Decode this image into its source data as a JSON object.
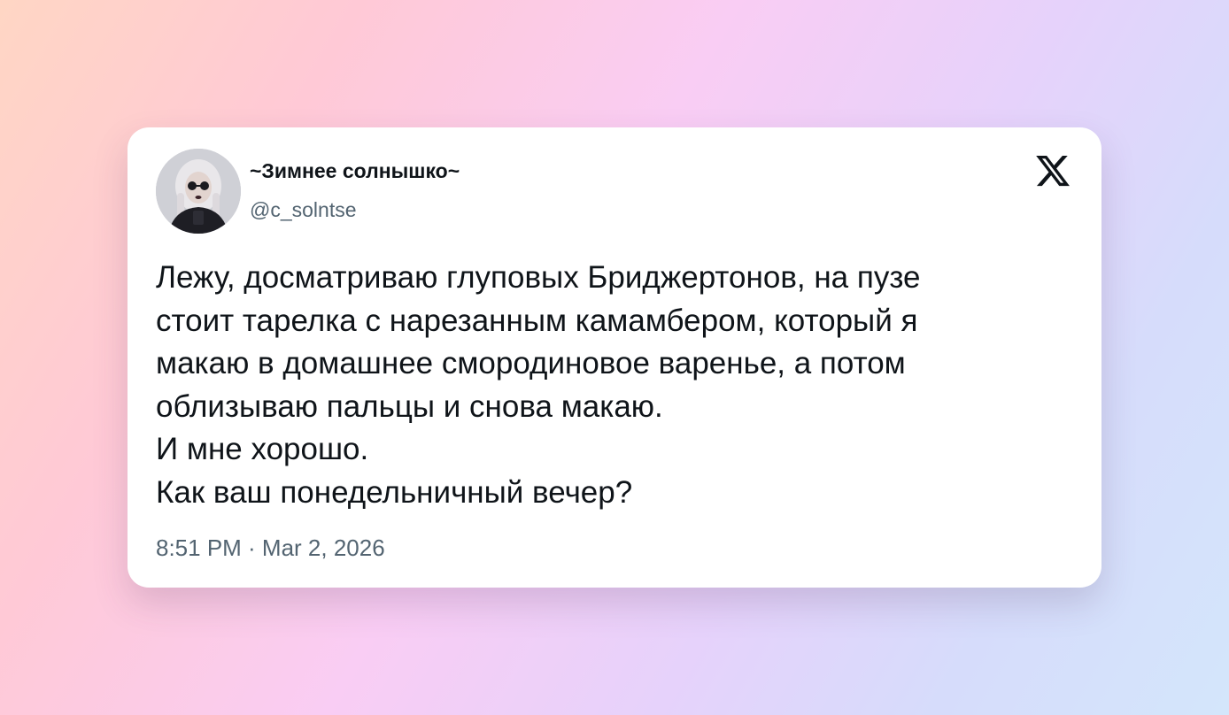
{
  "author": {
    "display_name": "~Зимнее солнышко~",
    "handle": "@c_solntse"
  },
  "tweet": {
    "lines": [
      "Лежу, досматриваю глуповых Бриджертонов, на пузе",
      "стоит тарелка с нарезанным камамбером, который я",
      "макаю в домашнее смородиновое варенье, а потом",
      "облизываю пальцы и снова макаю.",
      "И мне хорошо.",
      "Как ваш понедельничный вечер?"
    ],
    "timestamp": "8:51 PM · Mar 2, 2026"
  },
  "icons": {
    "brand_logo": "x-logo-icon",
    "avatar": "user-avatar"
  },
  "colors": {
    "text_primary": "#0f1419",
    "text_secondary": "#536471",
    "card_background": "#ffffff"
  }
}
